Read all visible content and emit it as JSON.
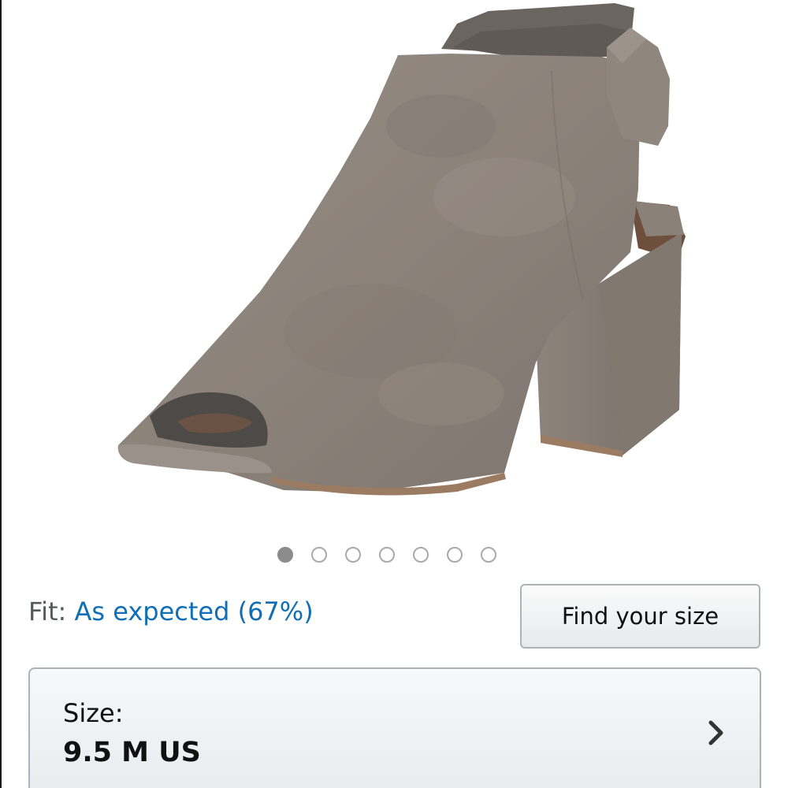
{
  "product": {
    "image_icon": "peep-toe-block-heel-bootie-image",
    "image_colors": {
      "suede": "#8a8179",
      "lining": "#5f5a55",
      "sole": "#9b7c62"
    }
  },
  "carousel": {
    "total": 7,
    "active_index": 0
  },
  "fit": {
    "label": "Fit:",
    "value": "As expected (67%)"
  },
  "find_size_button": {
    "label": "Find your size"
  },
  "size_selector": {
    "label": "Size:",
    "value": "9.5 M US",
    "icon": "chevron-right-icon"
  },
  "colors": {
    "link": "#0f6eb5",
    "muted_text": "#565959",
    "button_border": "#adb1b8"
  }
}
